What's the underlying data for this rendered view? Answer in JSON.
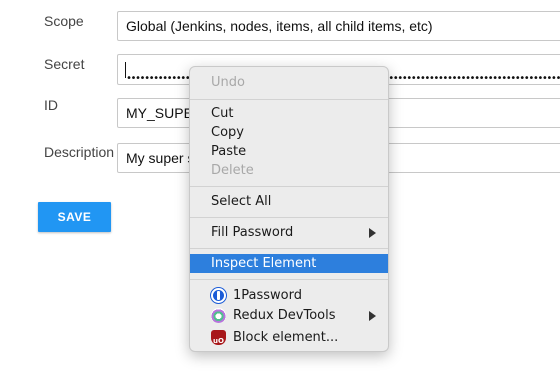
{
  "form": {
    "scope_label": "Scope",
    "scope_value": "Global (Jenkins, nodes, items, all child items, etc)",
    "secret_label": "Secret",
    "secret_value": "••••••••••••••••••••••••••••••••••••••••••••••••••••••••••••••••••••••••••••••••••••••••••••••••••••••••",
    "id_label": "ID",
    "id_value": "MY_SUPE",
    "description_label": "Description",
    "description_value": "My super s",
    "save_label": "SAVE"
  },
  "context_menu": {
    "undo": "Undo",
    "cut": "Cut",
    "copy": "Copy",
    "paste": "Paste",
    "delete": "Delete",
    "select_all": "Select All",
    "fill_password": "Fill Password",
    "inspect_element": "Inspect Element",
    "onepassword": "1Password",
    "redux_devtools": "Redux DevTools",
    "block_element": "Block element...",
    "highlight_color": "#2d7fdd",
    "icons": {
      "onepassword": "1password-icon",
      "redux": "redux-devtools-icon",
      "ublock": "ublock-icon"
    }
  },
  "accent_color": "#2196f3"
}
